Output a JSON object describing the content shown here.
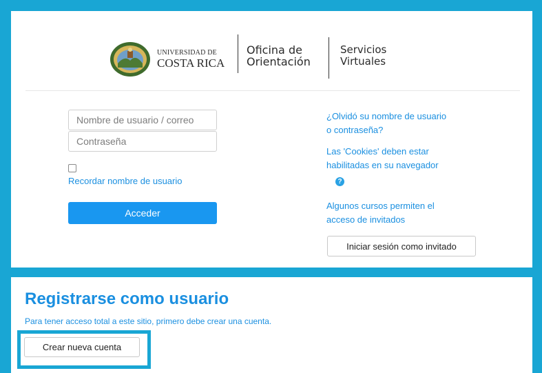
{
  "header": {
    "logo": {
      "university_line1": "UNIVERSIDAD DE",
      "university_line2": "COSTA RICA",
      "seal_icon": "university-seal-icon"
    },
    "office": [
      "Oficina de",
      "Orientación"
    ],
    "service": [
      "Servicios",
      "Virtuales"
    ]
  },
  "login": {
    "username_placeholder": "Nombre de usuario / correo",
    "password_placeholder": "Contraseña",
    "remember_checked": false,
    "remember_label": "Recordar nombre de usuario",
    "submit_label": "Acceder"
  },
  "help": {
    "forgot_line1": "¿Olvidó su nombre de usuario",
    "forgot_line2": "o contraseña?",
    "cookies_line1": "Las 'Cookies' deben estar",
    "cookies_line2": "habilitadas en su navegador",
    "help_icon": "question-circle-icon",
    "guest_line1": "Algunos cursos permiten el",
    "guest_line2": "acceso de invitados",
    "guest_button": "Iniciar sesión como invitado"
  },
  "signup": {
    "title": "Registrarse como usuario",
    "description": "Para tener acceso total a este sitio, primero debe crear una cuenta.",
    "create_button": "Crear nueva cuenta"
  },
  "colors": {
    "frame": "#19a6d4",
    "link": "#1a8fe0",
    "primary_button": "#1997f0"
  }
}
